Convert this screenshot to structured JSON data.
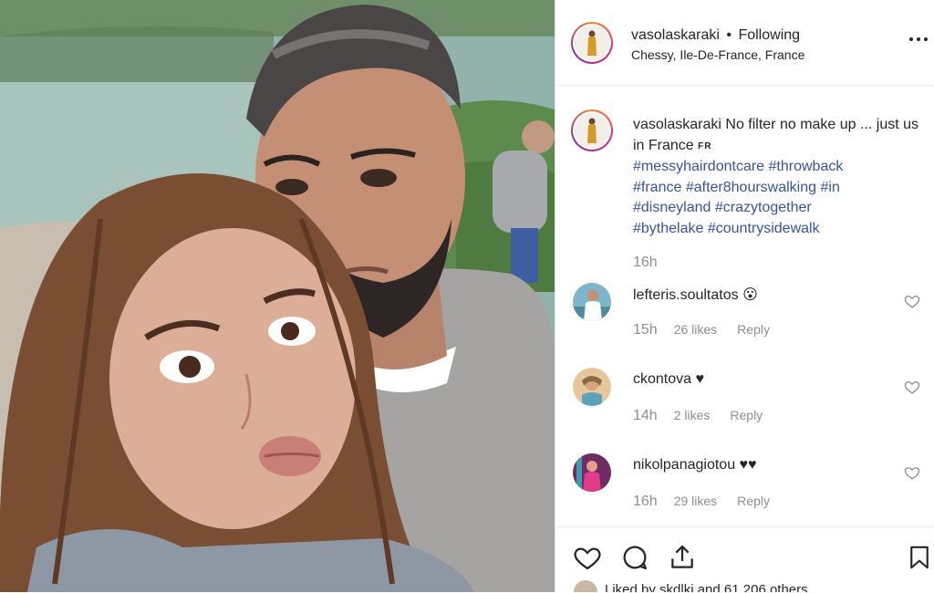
{
  "post": {
    "username": "vasolaskaraki",
    "separator": "•",
    "follow_status": "Following",
    "location": "Chessy, Ile-De-France, France"
  },
  "caption": {
    "username": "vasolaskaraki",
    "text": "No filter no make up ... just us in France",
    "flag": "FR",
    "hashtags": [
      "#messyhairdontcare",
      "#throwback",
      "#france",
      "#after8hourswalking",
      "#in",
      "#disneyland",
      "#crazytogether",
      "#bythelake",
      "#countrysidewalk"
    ],
    "time": "16h"
  },
  "comments": [
    {
      "username": "lefteris.soultatos",
      "text": "😮",
      "time": "15h",
      "likes": "26 likes",
      "reply": "Reply"
    },
    {
      "username": "ckontova",
      "text": "♥",
      "time": "14h",
      "likes": "2 likes",
      "reply": "Reply"
    },
    {
      "username": "nikolpanagiotou",
      "text": "♥♥",
      "time": "16h",
      "likes": "29 likes",
      "reply": "Reply"
    }
  ],
  "actions": {
    "like_icon": "heart-icon",
    "comment_icon": "comment-icon",
    "share_icon": "share-icon",
    "save_icon": "bookmark-icon"
  },
  "liked_by_partial": "Liked by skdlkj and 61,206 others",
  "colors": {
    "hashtag": "#38549b",
    "muted": "#8e8e8e",
    "text": "#262626"
  }
}
